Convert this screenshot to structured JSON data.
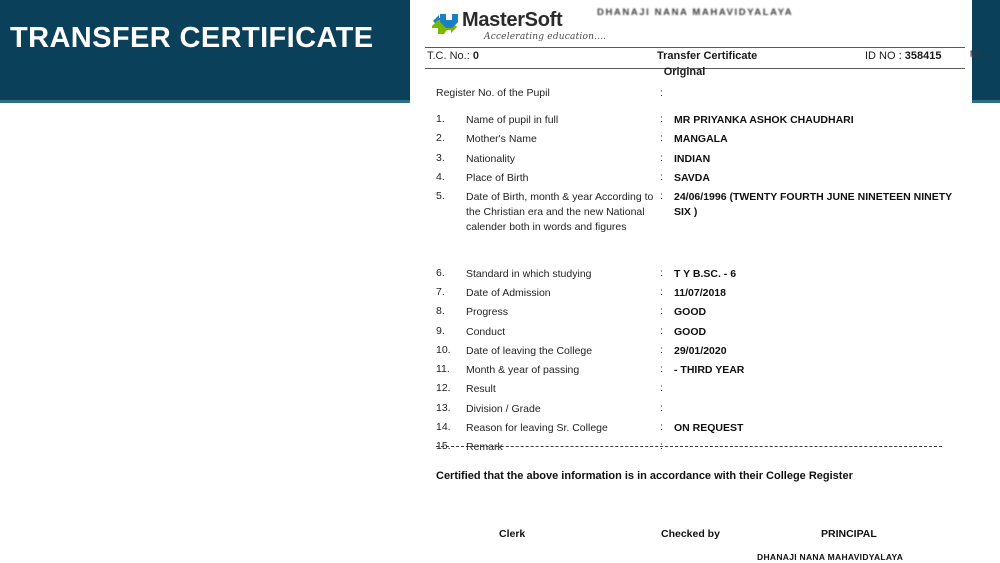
{
  "slide": {
    "title": "TRANSFER CERTIFICATE",
    "band_color": "#0a4059",
    "band_rule_color": "#2f6f88"
  },
  "document": {
    "logo": {
      "icon": "mastersoft-arrows-logo",
      "wordmark": "MasterSoft",
      "tagline": "Accelerating education....",
      "blue": "#1b7fc4",
      "green": "#7ab800"
    },
    "college_header": "DHANAJI NANA MAHAVIDYALAYA",
    "tc_bar": {
      "tc_label": "T.C. No.:",
      "tc_value": "0",
      "center_title": "Transfer Certificate",
      "id_label": "ID NO :",
      "id_value": "358415",
      "cut_text": "M...."
    },
    "original_label": "Original",
    "register_row": {
      "label": "Register No. of the Pupil",
      "colon": ":",
      "value": ""
    },
    "colon": ":",
    "rows": [
      {
        "num": "1.",
        "label": "Name of pupil in full",
        "value": "MR PRIYANKA ASHOK CHAUDHARI"
      },
      {
        "num": "2.",
        "label": "Mother's Name",
        "value": "MANGALA"
      },
      {
        "num": "3.",
        "label": "Nationality",
        "value": "INDIAN"
      },
      {
        "num": "4.",
        "label": "Place of Birth",
        "value": "SAVDA"
      },
      {
        "num": "5.",
        "label": "Date of Birth, month & year According to the Christian era and the new National calender both in words and figures",
        "value": "24/06/1996 (TWENTY FOURTH JUNE NINETEEN NINETY SIX )"
      },
      {
        "num": "6.",
        "label": "Standard in which studying",
        "value": "T Y B.SC. - 6"
      },
      {
        "num": "7.",
        "label": "Date of Admission",
        "value": "11/07/2018"
      },
      {
        "num": "8.",
        "label": "Progress",
        "value": "GOOD"
      },
      {
        "num": "9.",
        "label": "Conduct",
        "value": "GOOD"
      },
      {
        "num": "10.",
        "label": "Date of leaving the College",
        "value": "29/01/2020"
      },
      {
        "num": "11.",
        "label": "Month & year of passing",
        "value": "- THIRD YEAR"
      },
      {
        "num": "12.",
        "label": "Result",
        "value": ""
      },
      {
        "num": "13.",
        "label": "Division / Grade",
        "value": ""
      },
      {
        "num": "14.",
        "label": "Reason for leaving Sr. College",
        "value": "ON REQUEST"
      },
      {
        "num": "15.",
        "label": "Remark",
        "value": ""
      }
    ],
    "certified_text": "Certified that the above information is in accordance with their College Register",
    "signatures": {
      "clerk": "Clerk",
      "checked_by": "Checked by",
      "principal": "PRINCIPAL",
      "college": "DHANAJI NANA MAHAVIDYALAYA"
    }
  }
}
